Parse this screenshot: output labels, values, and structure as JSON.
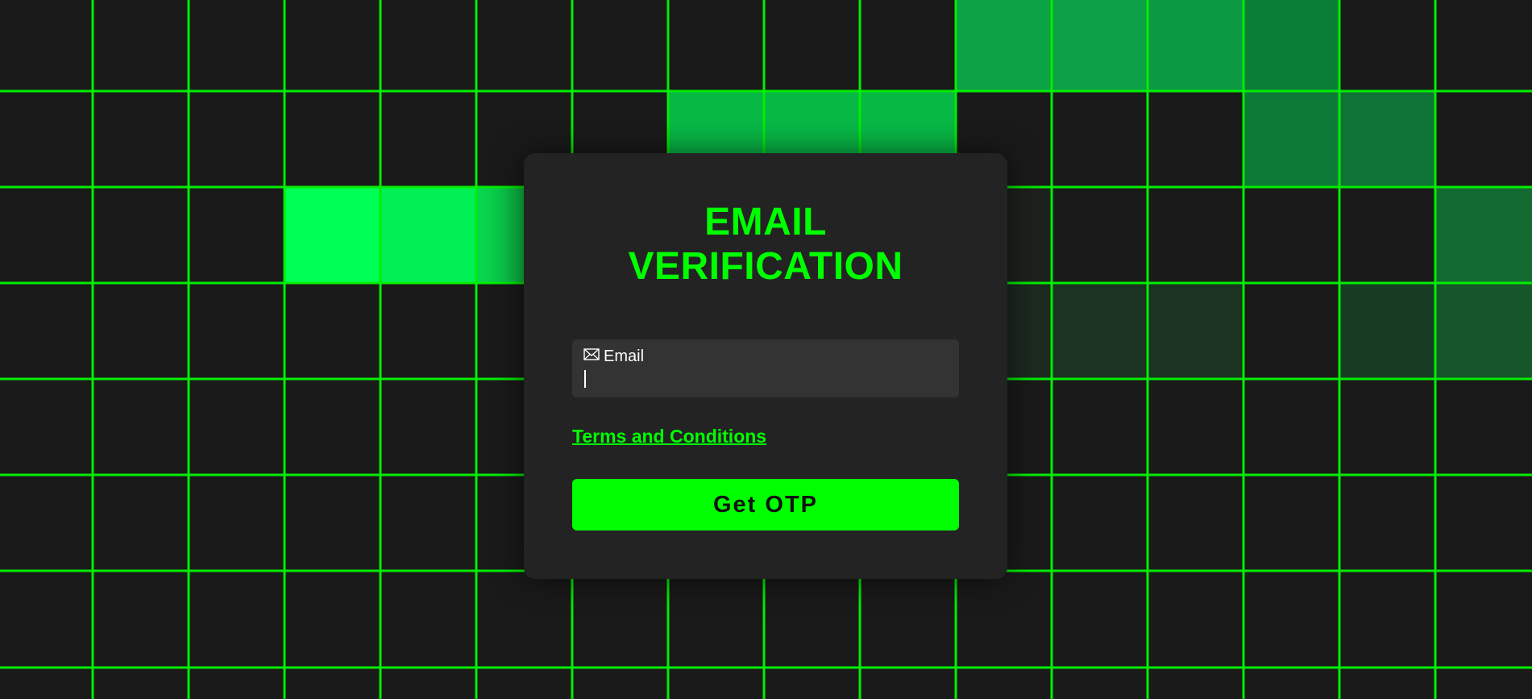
{
  "page": {
    "title": "EMAIL\nVERIFICATION"
  },
  "form": {
    "title_line1": "EMAIL",
    "title_line2": "VERIFICATION",
    "email_label": "Email",
    "email_icon": "envelope-icon",
    "email_value": "",
    "terms_link": "Terms and Conditions",
    "submit_label": "Get OTP"
  },
  "theme": {
    "accent": "#00ff00",
    "background": "#1a1a1a",
    "card": "#232323",
    "field": "#333333"
  }
}
